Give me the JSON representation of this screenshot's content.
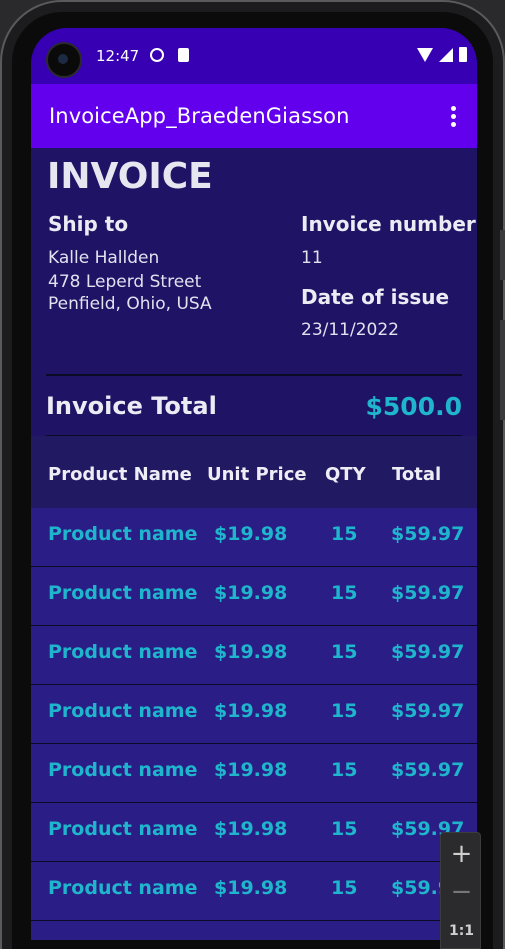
{
  "status_bar": {
    "time": "12:47"
  },
  "app_bar": {
    "title": "InvoiceApp_BraedenGiasson"
  },
  "invoice": {
    "heading": "INVOICE",
    "ship_to_label": "Ship to",
    "ship_to_name": "Kalle Hallden",
    "ship_to_street": "478 Leperd Street",
    "ship_to_city": "Penfield, Ohio, USA",
    "invoice_number_label": "Invoice number",
    "invoice_number": "11",
    "date_label": "Date of issue",
    "date": "23/11/2022",
    "total_label": "Invoice Total",
    "total_value": "$500.0"
  },
  "table": {
    "headers": [
      "Product Name",
      "Unit Price",
      "QTY",
      "Total"
    ],
    "rows": [
      [
        "Product name",
        "$19.98",
        "15",
        "$59.97"
      ],
      [
        "Product name",
        "$19.98",
        "15",
        "$59.97"
      ],
      [
        "Product name",
        "$19.98",
        "15",
        "$59.97"
      ],
      [
        "Product name",
        "$19.98",
        "15",
        "$59.97"
      ],
      [
        "Product name",
        "$19.98",
        "15",
        "$59.97"
      ],
      [
        "Product name",
        "$19.98",
        "15",
        "$59.97"
      ],
      [
        "Product name",
        "$19.98",
        "15",
        "$59.9"
      ]
    ]
  },
  "zoom_controls": {
    "zoom_in": "+",
    "zoom_out": "−",
    "ratio": "1:1"
  },
  "colors": {
    "status_bar": "#3700b3",
    "app_bar": "#6200ee",
    "background": "#1f1366",
    "accent": "#1fb5cc"
  }
}
